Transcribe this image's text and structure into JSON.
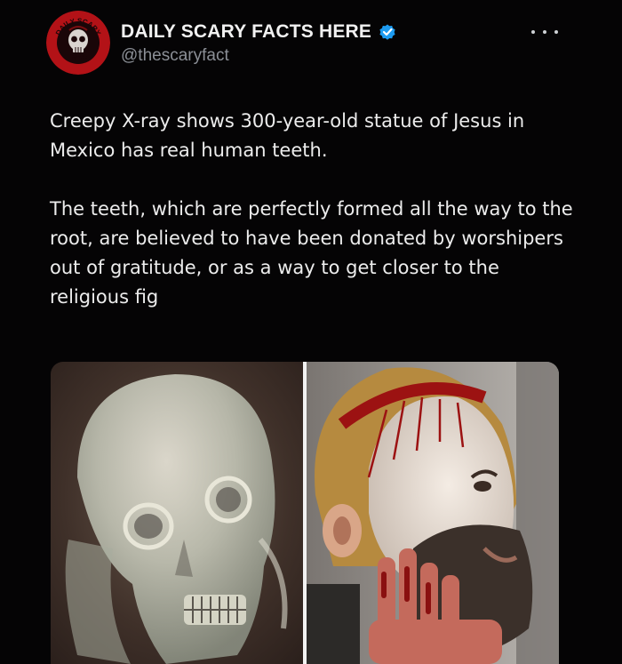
{
  "author": {
    "display_name": "DAILY SCARY FACTS HERE",
    "handle": "@thescaryfact",
    "verified": true,
    "avatar_icon": "skull-logo-icon",
    "avatar_text_top": "DAILY SCARY",
    "avatar_text_bottom": "FACTS"
  },
  "menu": {
    "icon": "more-options-icon"
  },
  "tweet": {
    "paragraph_1": "Creepy X-ray shows 300-year-old statue of Jesus in Mexico has real human teeth.",
    "paragraph_2": "The teeth, which are perfectly formed all the way to the root, are believed to have been donated by worshipers out of gratitude, or as a way to get closer to the religious fig"
  },
  "media": {
    "left_image": "xray-skull-image",
    "right_image": "statue-head-image"
  },
  "colors": {
    "background": "#050405",
    "text": "#ececec",
    "handle": "#8b8f96",
    "verified": "#1d9bf0",
    "avatar_red": "#b31217"
  }
}
